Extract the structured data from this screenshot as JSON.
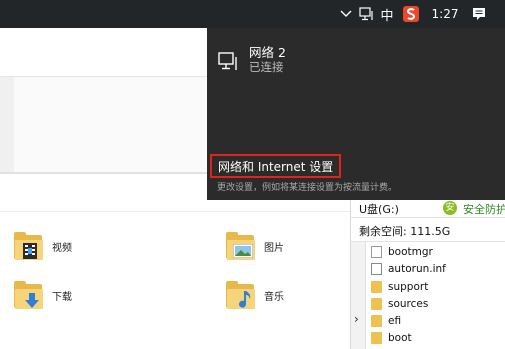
{
  "taskbar": {
    "chevron_icon": "chevron-up-icon",
    "network_icon": "network-icon",
    "ime_label": "中",
    "sogou_icon": "sogou-icon",
    "time": "1:27",
    "notification_icon": "notification-icon"
  },
  "explorer": {
    "items": [
      {
        "label": "视频",
        "icon": "video-folder-icon"
      },
      {
        "label": "图片",
        "icon": "pictures-folder-icon"
      },
      {
        "label": "下载",
        "icon": "downloads-folder-icon"
      },
      {
        "label": "音乐",
        "icon": "music-folder-icon"
      }
    ]
  },
  "drive_panel": {
    "title": "U盘(G:)",
    "badge": "安",
    "security_label": "安全防护",
    "free_space": "剩余空间: 111.5G",
    "expand_icon": "chevron-right-icon",
    "files": [
      {
        "name": "bootmgr",
        "icon": "file-icon"
      },
      {
        "name": "autorun.inf",
        "icon": "config-file-icon"
      },
      {
        "name": "support",
        "icon": "folder-icon"
      },
      {
        "name": "sources",
        "icon": "folder-icon"
      },
      {
        "name": "efi",
        "icon": "folder-icon"
      },
      {
        "name": "boot",
        "icon": "folder-icon"
      }
    ]
  },
  "network_flyout": {
    "network_name": "网络 2",
    "status": "已连接",
    "settings_link": "网络和 Internet 设置",
    "settings_description": "更改设置，例如将某连接设置为按流量计费。",
    "highlight_color": "#e2231a"
  }
}
